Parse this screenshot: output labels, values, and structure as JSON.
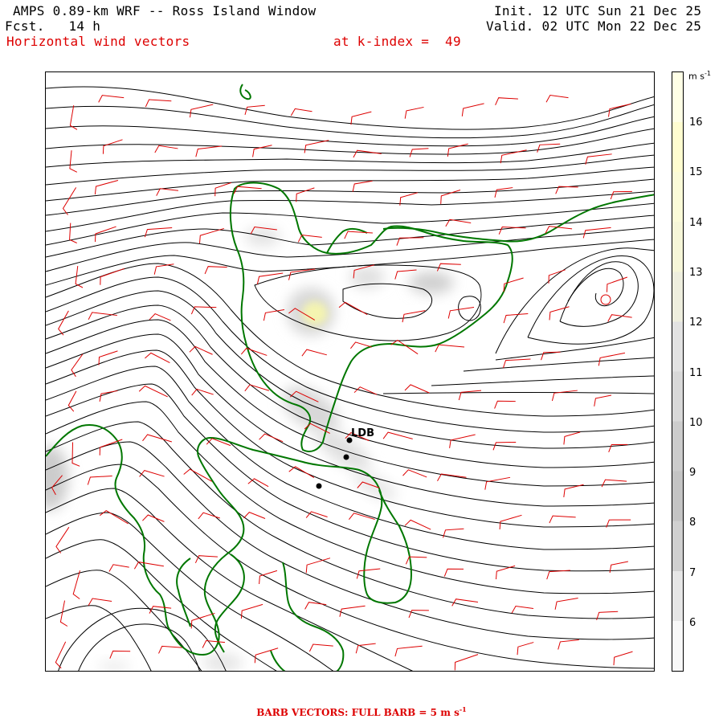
{
  "header": {
    "title": "AMPS 0.89-km WRF -- Ross Island Window",
    "forecast": "Fcst.   14 h",
    "field": "Horizontal wind vectors",
    "level": "at k-index =  49",
    "init": "Init. 12 UTC Sun 21 Dec 25",
    "valid": "Valid. 02 UTC Mon 22 Dec 25"
  },
  "colorbar": {
    "units": "m s",
    "units_exp": "-1",
    "labels": [
      "16",
      "15",
      "14",
      "13",
      "12",
      "11",
      "10",
      "9",
      "8",
      "7",
      "6"
    ],
    "colors": [
      "#ffffe6",
      "#fffdd0",
      "#fbfbd8",
      "#f6f6d8",
      "#eeeede",
      "#e2e2e2",
      "#d8d8d8",
      "#cccccc",
      "#c4c4c4",
      "#d0d0d0",
      "#e6e6e6",
      "#f8f8f8"
    ]
  },
  "map": {
    "station": "LDB",
    "coast_color": "#007700",
    "barb_color": "#dd0000",
    "line_color": "#000000"
  },
  "footer": {
    "text": "BARB VECTORS:  FULL BARB = 5 m s",
    "exp": "-1"
  }
}
